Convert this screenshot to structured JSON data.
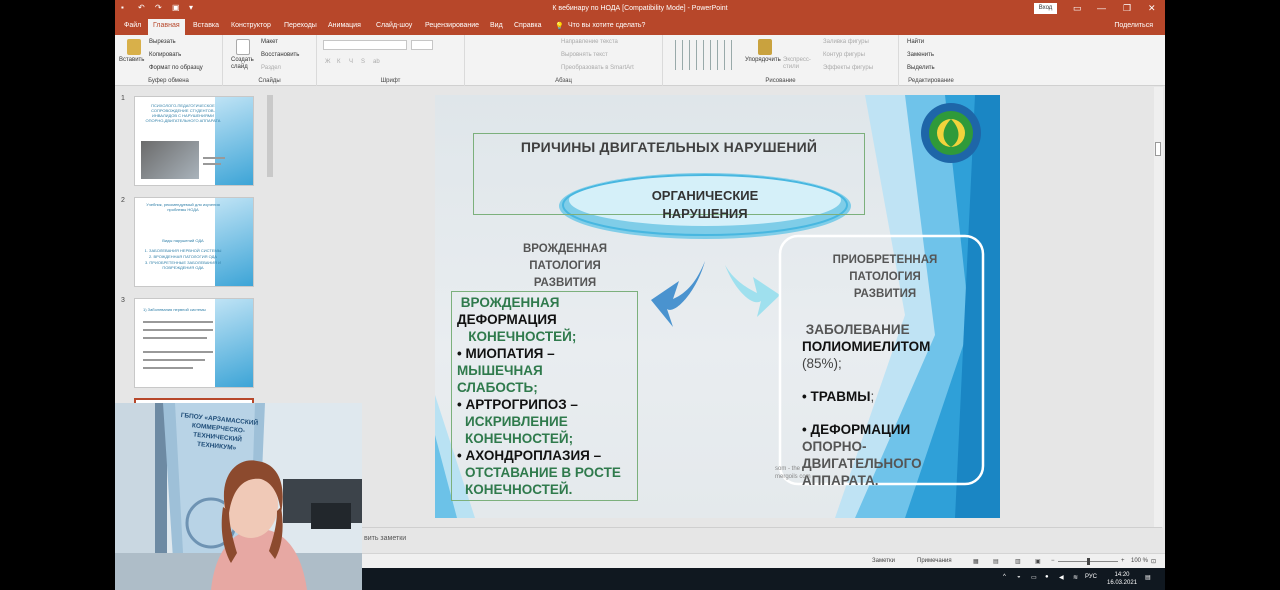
{
  "window": {
    "title": "К вебинару по НОДА [Compatibility Mode] - PowerPoint",
    "login_label": "Вход",
    "share_label": "Поделиться"
  },
  "tabs": [
    {
      "label": "Файл"
    },
    {
      "label": "Главная",
      "active": true
    },
    {
      "label": "Вставка"
    },
    {
      "label": "Конструктор"
    },
    {
      "label": "Переходы"
    },
    {
      "label": "Анимация"
    },
    {
      "label": "Слайд-шоу"
    },
    {
      "label": "Рецензирование"
    },
    {
      "label": "Вид"
    },
    {
      "label": "Справка"
    },
    {
      "label": "Что вы хотите сделать?"
    }
  ],
  "ribbon": {
    "clipboard": {
      "paste": "Вставить",
      "cut": "Вырезать",
      "copy": "Копировать",
      "format_painter": "Формат по образцу",
      "group_label": "Буфер обмена"
    },
    "slides": {
      "new_slide": "Создать слайд",
      "layout": "Макет",
      "reset": "Восстановить",
      "section": "Раздел",
      "group_label": "Слайды"
    },
    "font": {
      "group_label": "Шрифт",
      "buttons": [
        "Ж",
        "К",
        "Ч",
        "S",
        "ab"
      ]
    },
    "paragraph": {
      "text_direction": "Направление текста",
      "align_text": "Выровнять текст",
      "smartart": "Преобразовать в SmartArt",
      "group_label": "Абзац"
    },
    "drawing": {
      "arrange": "Упорядочить",
      "quick_styles": "Экспресс-стили",
      "shape_fill": "Заливка фигуры",
      "shape_outline": "Контур фигуры",
      "shape_effects": "Эффекты фигуры",
      "group_label": "Рисование"
    },
    "editing": {
      "find": "Найти",
      "replace": "Заменить",
      "select": "Выделить",
      "group_label": "Редактирование"
    }
  },
  "thumbnails": [
    {
      "number": "1",
      "title": "ПСИХОЛОГО-ПЕДАГОГИЧЕСКОЕ СОПРОВОЖДЕНИЕ СТУДЕНТОВ-ИНВАЛИДОВ С НАРУШЕНИЯМИ ОПОРНО-ДВИГАТЕЛЬНОГО АППАРАТА"
    },
    {
      "number": "2",
      "title": "Учебник, рекомендуемый для изучения проблемы НОДА",
      "subtitle": "Виды нарушений ОДА",
      "items": [
        "1. ЗАБОЛЕВАНИЯ НЕРВНОЙ СИСТЕМЫ",
        "2. ВРОЖДЕННАЯ ПАТОЛОГИЯ ОДА",
        "3. ПРИОБРЕТЕННЫЕ ЗАБОЛЕВАНИЯ И ПОВРЕЖДЕНИЯ ОДА"
      ]
    },
    {
      "number": "3",
      "title": "1) Заболевания нервной системы"
    }
  ],
  "slide": {
    "title": "ПРИЧИНЫ ДВИГАТЕЛЬНЫХ НАРУШЕНИЙ",
    "center_line1": "ОРГАНИЧЕСКИЕ",
    "center_line2": "НАРУШЕНИЯ",
    "left_heading": [
      "ВРОЖДЕННАЯ",
      "ПАТОЛОГИЯ",
      "РАЗВИТИЯ"
    ],
    "right_heading": [
      "ПРИОБРЕТЕННАЯ",
      "ПАТОЛОГИЯ",
      "РАЗВИТИЯ"
    ],
    "left_items": [
      {
        "bold": "ВРОЖДЕННАЯ",
        "rest_k": "ДЕФОРМАЦИЯ",
        "rest_g": "КОНЕЧНОСТЕЙ;"
      },
      {
        "bold": "• МИОПАТИЯ –",
        "rest_g": "МЫШЕЧНАЯ СЛАБОСТЬ;"
      },
      {
        "bold": "• АРТРОГРИПОЗ –",
        "rest_g": "ИСКРИВЛЕНИЕ КОНЕЧНОСТЕЙ;"
      },
      {
        "bold": "• АХОНДРОПЛАЗИЯ –",
        "rest_g": "ОТСТАВАНИЕ В РОСТЕ КОНЕЧНОСТЕЙ."
      }
    ],
    "right_items": [
      {
        "g": "ЗАБОЛЕВАНИЕ",
        "k": "ПОЛИОМИЕЛИТОМ",
        "n": "(85%);"
      },
      {
        "k": "• ТРАВМЫ",
        "n": ";"
      },
      {
        "k": "• ДЕФОРМАЦИИ",
        "g": "ОПОРНО-ДВИГАТЕЛЬНОГО АППАРАТА."
      }
    ],
    "watermark": "som - the mergoils com"
  },
  "notes_placeholder": "вить заметки",
  "status": {
    "notes": "Заметки",
    "comments": "Примечания",
    "zoom": "100 %",
    "zoom_level": 0.5
  },
  "taskbar": {
    "lang": "РУС",
    "time": "14:20",
    "date": "16.03.2021"
  },
  "webcam": {
    "banner_text": "ГБПОУ «АРЗАМАССКИЙ КОММЕРЧЕСКО-ТЕХНИЧЕСКИЙ ТЕХНИКУМ»"
  },
  "colors": {
    "ppt_red": "#b7472a",
    "accent_green": "#2f7a4c",
    "accent_blue": "#3aa3d6"
  }
}
